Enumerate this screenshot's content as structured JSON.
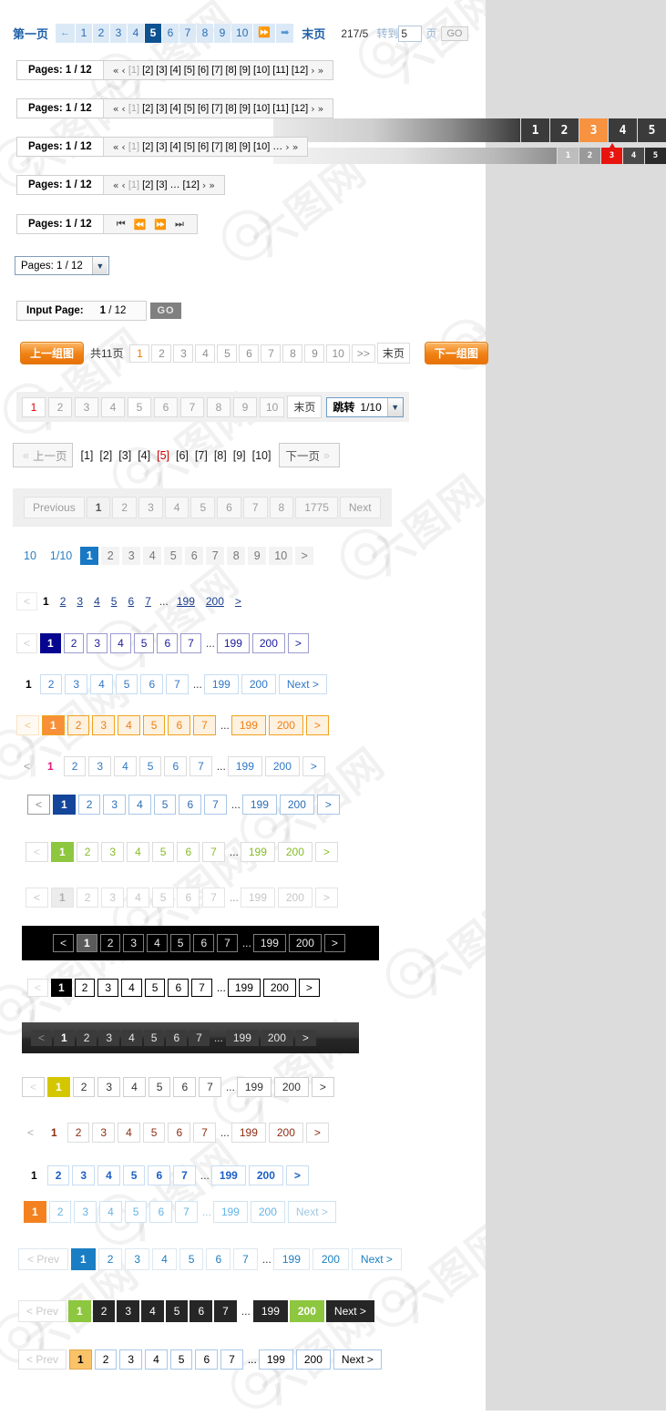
{
  "row1": {
    "first_label": "第一页",
    "prev_arrow": "←",
    "pages": [
      "1",
      "2",
      "3",
      "4",
      "5",
      "6",
      "7",
      "8",
      "9",
      "10"
    ],
    "active": "5",
    "fast_forward": "⏩",
    "next_arrow": "➡",
    "last_label": "末页",
    "ratio": "217/5",
    "goto_label": "转到",
    "goto_value": "5",
    "page_unit": "页",
    "go_label": "GO"
  },
  "pages_bars": [
    {
      "title": "Pages: 1 / 12",
      "first": "«",
      "prev": "‹",
      "items": [
        "[1]",
        "[2]",
        "[3]",
        "[4]",
        "[5]",
        "[6]",
        "[7]",
        "[8]",
        "[9]",
        "[10]",
        "[11]",
        "[12]"
      ],
      "current": "[1]",
      "next": "›",
      "last": "»"
    },
    {
      "title": "Pages: 1 / 12",
      "first": "«",
      "prev": "‹",
      "items": [
        "[1]",
        "[2]",
        "[3]",
        "[4]",
        "[5]",
        "[6]",
        "[7]",
        "[8]",
        "[9]",
        "[10]",
        "[11]",
        "[12]"
      ],
      "current": "[1]",
      "next": "›",
      "last": "»"
    },
    {
      "title": "Pages: 1 / 12",
      "first": "«",
      "prev": "‹",
      "items": [
        "[1]",
        "[2]",
        "[3]",
        "[4]",
        "[5]",
        "[6]",
        "[7]",
        "[8]",
        "[9]",
        "[10]",
        "…"
      ],
      "current": "[1]",
      "next": "›",
      "last": "»"
    },
    {
      "title": "Pages: 1 / 12",
      "first": "«",
      "prev": "‹",
      "items": [
        "[1]",
        "[2]",
        "[3]",
        "…",
        "[12]"
      ],
      "current": "[1]",
      "next": "›",
      "last": "»"
    }
  ],
  "media_bar": {
    "title": "Pages: 1 / 12",
    "controls": [
      "⏮",
      "⏪",
      "⏩",
      "⏭"
    ]
  },
  "dropdown": {
    "value": "Pages: 1 / 12",
    "caret": "▼"
  },
  "input_page": {
    "label": "Input Page:",
    "current": "1",
    "separator": "/",
    "total": "12",
    "go_label": "GO"
  },
  "group_row": {
    "prev_group": "上一组图",
    "next_group": "下一组图",
    "total_text": "共11页",
    "pages": [
      "1",
      "2",
      "3",
      "4",
      "5",
      "6",
      "7",
      "8",
      "9",
      "10"
    ],
    "active": "1",
    "more": ">>",
    "last_label": "末页"
  },
  "jump_row": {
    "pages": [
      "1",
      "2",
      "3",
      "4",
      "5",
      "6",
      "7",
      "8",
      "9",
      "10"
    ],
    "active": "1",
    "white": "5",
    "last_label": "末页",
    "jump_label": "跳转",
    "jump_value": "1/10",
    "caret": "▼"
  },
  "bracket_row": {
    "first": "«",
    "prev_label": "上一页",
    "items": [
      "[1]",
      "[2]",
      "[3]",
      "[4]",
      "[5]",
      "[6]",
      "[7]",
      "[8]",
      "[9]",
      "[10]"
    ],
    "active": "[5]",
    "next_label": "下一页",
    "last": "»"
  },
  "prev_next_row": {
    "prev": "Previous",
    "pages": [
      "1",
      "2",
      "3",
      "4",
      "5",
      "6",
      "7",
      "8",
      "1775"
    ],
    "active": "1",
    "next": "Next"
  },
  "flat_blue_row": {
    "total": "10",
    "ratio": "1/10",
    "pages": [
      "1",
      "2",
      "3",
      "4",
      "5",
      "6",
      "7",
      "8",
      "9",
      "10"
    ],
    "active": "1",
    "next": ">"
  },
  "common": {
    "prev": "<",
    "next": ">",
    "dots": "...",
    "pages_head": [
      "1",
      "2",
      "3",
      "4",
      "5",
      "6",
      "7"
    ],
    "pages_tail": [
      "199",
      "200"
    ],
    "active": "1",
    "next_text": "Next >",
    "prev_text": "< Prev"
  },
  "sidebar": {
    "strip_a": {
      "items": [
        "1",
        "2",
        "3",
        "4",
        "5"
      ],
      "active": "3"
    },
    "strip_b": {
      "items": [
        "1",
        "2",
        "3",
        "4",
        "5"
      ],
      "active": "3"
    }
  },
  "watermark": {
    "text": "六图网"
  }
}
